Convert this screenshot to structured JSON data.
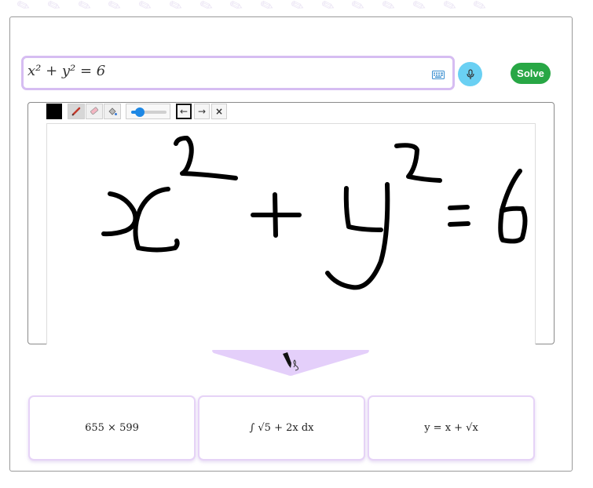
{
  "math_input": {
    "expression": "x² + y² = 6"
  },
  "buttons": {
    "solve_label": "Solve"
  },
  "toolbar": {
    "stroke_color": "#000000",
    "brush_size_fraction": 0.15,
    "undo_glyph": "←",
    "redo_glyph": "→",
    "clear_glyph": "×"
  },
  "suggestions": [
    {
      "expression": "655 × 599"
    },
    {
      "expression": "∫ √5 + 2x dx"
    },
    {
      "expression": "y = x + √x"
    }
  ],
  "colors": {
    "accent_purple": "#d6bdf2",
    "solve_green": "#28a745",
    "mic_blue": "#6ad0f3",
    "slider_blue": "#1e88e5"
  },
  "icons": [
    "keyboard-icon",
    "microphone-icon",
    "pen-icon",
    "eraser-icon",
    "fill-icon",
    "handwriting-pen-icon"
  ]
}
